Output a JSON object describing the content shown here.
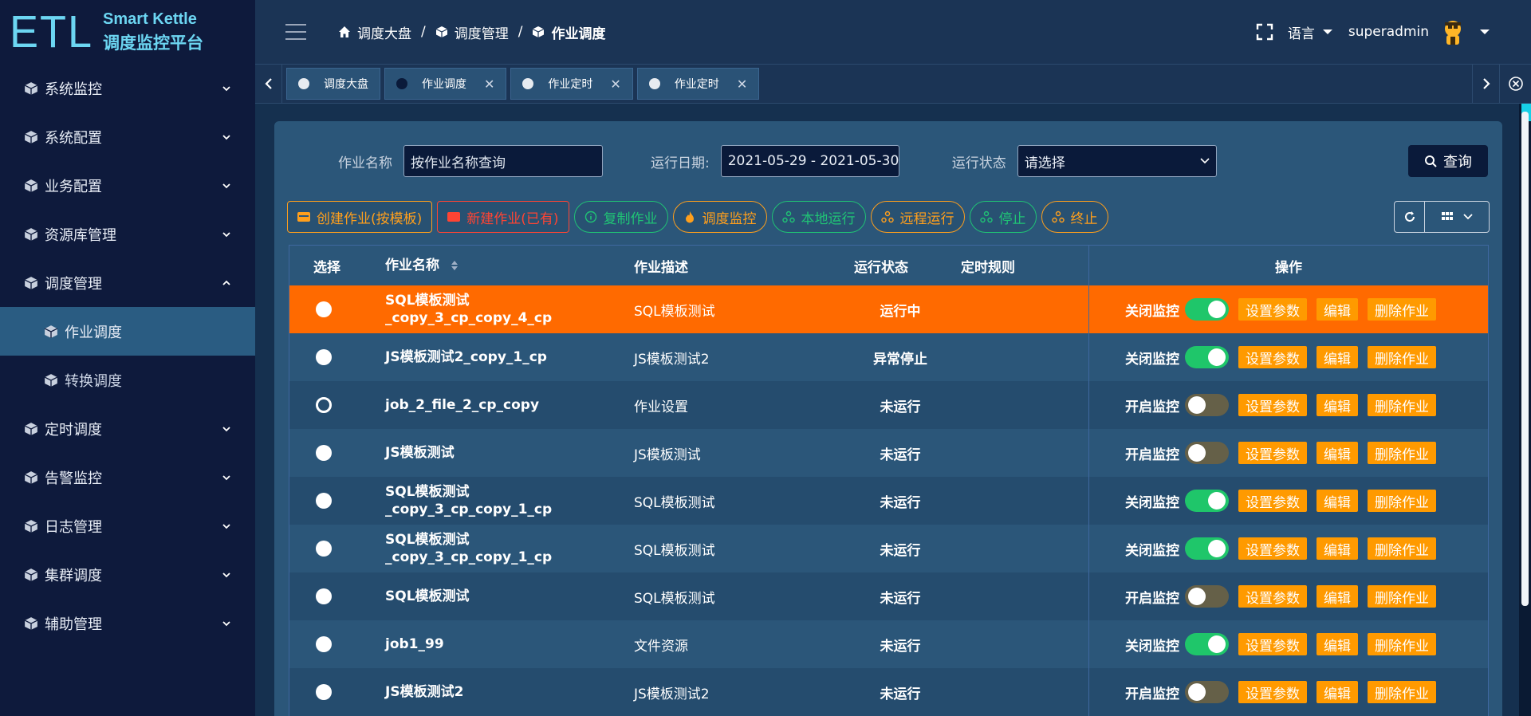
{
  "logo": {
    "mark": "ETL",
    "en": "Smart Kettle",
    "cn": "调度监控平台"
  },
  "sidebar": {
    "items": [
      {
        "label": "系统监控",
        "expanded": false
      },
      {
        "label": "系统配置",
        "expanded": false
      },
      {
        "label": "业务配置",
        "expanded": false
      },
      {
        "label": "资源库管理",
        "expanded": false
      },
      {
        "label": "调度管理",
        "expanded": true
      },
      {
        "label": "作业调度",
        "sub": true,
        "active": true
      },
      {
        "label": "转换调度",
        "sub": true,
        "active": false
      },
      {
        "label": "定时调度",
        "expanded": false
      },
      {
        "label": "告警监控",
        "expanded": false
      },
      {
        "label": "日志管理",
        "expanded": false
      },
      {
        "label": "集群调度",
        "expanded": false
      },
      {
        "label": "辅助管理",
        "expanded": false
      }
    ]
  },
  "header": {
    "breadcrumb": [
      "调度大盘",
      "调度管理",
      "作业调度"
    ],
    "lang": "语言",
    "user": "superadmin"
  },
  "tabs": [
    {
      "label": "调度大盘",
      "closable": false,
      "active": false
    },
    {
      "label": "作业调度",
      "closable": true,
      "active": true
    },
    {
      "label": "作业定时",
      "closable": true,
      "active": false
    },
    {
      "label": "作业定时",
      "closable": true,
      "active": false
    }
  ],
  "search": {
    "name_label": "作业名称",
    "name_placeholder": "按作业名称查询",
    "date_label": "运行日期:",
    "date_value": "2021-05-29 - 2021-05-30",
    "state_label": "运行状态",
    "state_placeholder": "请选择",
    "query_label": "查询"
  },
  "actions": {
    "create_template": "创建作业(按模板)",
    "create_existing": "新建作业(已有)",
    "copy": "复制作业",
    "monitor": "调度监控",
    "local_run": "本地运行",
    "remote_run": "远程运行",
    "stop": "停止",
    "terminate": "终止"
  },
  "table": {
    "headers": {
      "select": "选择",
      "name": "作业名称",
      "desc": "作业描述",
      "state": "运行状态",
      "rule": "定时规则",
      "ops": "操作"
    },
    "op_labels": {
      "params": "设置参数",
      "edit": "编辑",
      "delete": "删除作业"
    },
    "rows": [
      {
        "name": "SQL模板测试_copy_3_cp_copy_4_cp",
        "desc": "SQL模板测试",
        "state": "运行中",
        "monitor": "关闭监控",
        "on": true
      },
      {
        "name": "JS模板测试2_copy_1_cp",
        "desc": "JS模板测试2",
        "state": "异常停止",
        "monitor": "关闭监控",
        "on": true
      },
      {
        "name": "job_2_file_2_cp_copy",
        "desc": "作业设置",
        "state": "未运行",
        "monitor": "开启监控",
        "on": false
      },
      {
        "name": "JS模板测试",
        "desc": "JS模板测试",
        "state": "未运行",
        "monitor": "开启监控",
        "on": false
      },
      {
        "name": "SQL模板测试_copy_3_cp_copy_1_cp",
        "desc": "SQL模板测试",
        "state": "未运行",
        "monitor": "关闭监控",
        "on": true
      },
      {
        "name": "SQL模板测试_copy_3_cp_copy_1_cp",
        "desc": "SQL模板测试",
        "state": "未运行",
        "monitor": "关闭监控",
        "on": true
      },
      {
        "name": "SQL模板测试",
        "desc": "SQL模板测试",
        "state": "未运行",
        "monitor": "开启监控",
        "on": false
      },
      {
        "name": "job1_99",
        "desc": "文件资源",
        "state": "未运行",
        "monitor": "关闭监控",
        "on": true
      },
      {
        "name": "JS模板测试2",
        "desc": "JS模板测试2",
        "state": "未运行",
        "monitor": "开启监控",
        "on": false
      }
    ]
  },
  "colors": {
    "running_row": "#ff6a00",
    "accent_orange": "#ff9a00",
    "toggle_on": "#1fc66a"
  }
}
